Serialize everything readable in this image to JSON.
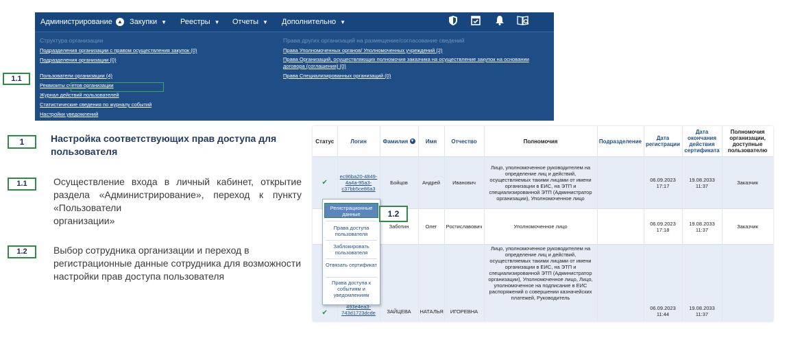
{
  "nav": {
    "menu": [
      {
        "label": "Администрирование",
        "active": true
      },
      {
        "label": "Закупки",
        "active": false
      },
      {
        "label": "Реестры",
        "active": false
      },
      {
        "label": "Отчеты",
        "active": false
      },
      {
        "label": "Дополнительно",
        "active": false
      }
    ],
    "icons": [
      "shield-icon",
      "calendar-check-icon",
      "bell-icon",
      "book-search-icon"
    ],
    "left_section_title": "Структура организации",
    "left_links": [
      "Подразделения организации с правом осуществления закупок (0)",
      "Подразделения организации (0)",
      "Пользователи организации (4)",
      "Реквизиты счетов организации",
      "Журнал действий пользователей",
      "Статистические сведения по журналу событий",
      "Настройки уведомлений"
    ],
    "right_section_title": "Права других организаций на размещение/согласование сведений",
    "right_links": [
      "Права Уполномоченных органов/ Уполномоченных учреждений (2)",
      "Права Организаций, осуществляющих полномочия заказчика на осуществление закупок на основании договора (соглашения) (0)",
      "Права Специализированных организаций (0)"
    ]
  },
  "tags": {
    "t1": "1",
    "t11": "1.1",
    "t12": "1.2",
    "nav_tag": "1.1",
    "ctx_tag": "1.2"
  },
  "steps": {
    "heading": "Настройка соответствующих прав доступа для пользователя",
    "step_11_lines": [
      "Осуществление входа в личный кабинет, открытие раздела «Администрирование», переход к пункту «Пользователи",
      "организации»"
    ],
    "step_12": "Выбор сотрудника организации и переход в регистрационные данные сотрудника для возможности настройки прав доступа пользователя"
  },
  "table": {
    "headers": [
      "Статус",
      "Логин",
      "Фамилия",
      "Имя",
      "Отчество",
      "Полномочия",
      "Подразделение",
      "Дата регистрации",
      "Дата окончания действия сертификата",
      "Полномочия организации, доступные пользователю"
    ],
    "rows": [
      {
        "login": "ec96ba20-4849-4a4a-95a3-c37bb5ce86a3",
        "surname": "Бойцов",
        "name": "Андрей",
        "patronymic": "Иванович",
        "rights": "Лицо, уполномоченное руководителем на определение лиц и действий, осуществляемых такими лицами от имени организации в ЕИС, на ЭТП и специализированной ЭТП (Администратор организации), Уполномоченное лицо",
        "department": "",
        "reg_date": "06.09.2023 17:17",
        "cert_date": "19.08.2033 11:37",
        "org_rights": "Заказчик"
      },
      {
        "login": "",
        "surname": "Заботин",
        "name": "Олег",
        "patronymic": "Ростиславович",
        "rights": "Уполномоченное лицо",
        "department": "",
        "reg_date": "06.09.2023 17:18",
        "cert_date": "19.08.2033 11:37",
        "org_rights": "Заказчик"
      },
      {
        "login": "493e4ea3-743d1723dcde",
        "surname": "ЗАЙЦЕВА",
        "name": "НАТАЛЬЯ",
        "patronymic": "ИГОРЕВНА",
        "rights": "Лицо, уполномоченное руководителем на определение лиц и действий, осуществляемых такими лицами от имени организации в ЕИС, на ЭТП и специализированной ЭТП (Администратор организации), Уполномоченное лицо, Лицо, уполномоченное на подписание в ЕИС распоряжений о совершении казначейских платежей, Руководитель",
        "department": "",
        "reg_date": "06.09.2023 11:44",
        "cert_date": "19.08.2033 11:37",
        "org_rights": ""
      }
    ]
  },
  "context_menu": [
    "Регистрационные данные",
    "Права доступа пользователя",
    "Заблокировать пользователя",
    "Отвязать сертификат",
    "Права доступа к событиям и уведомлениям"
  ]
}
